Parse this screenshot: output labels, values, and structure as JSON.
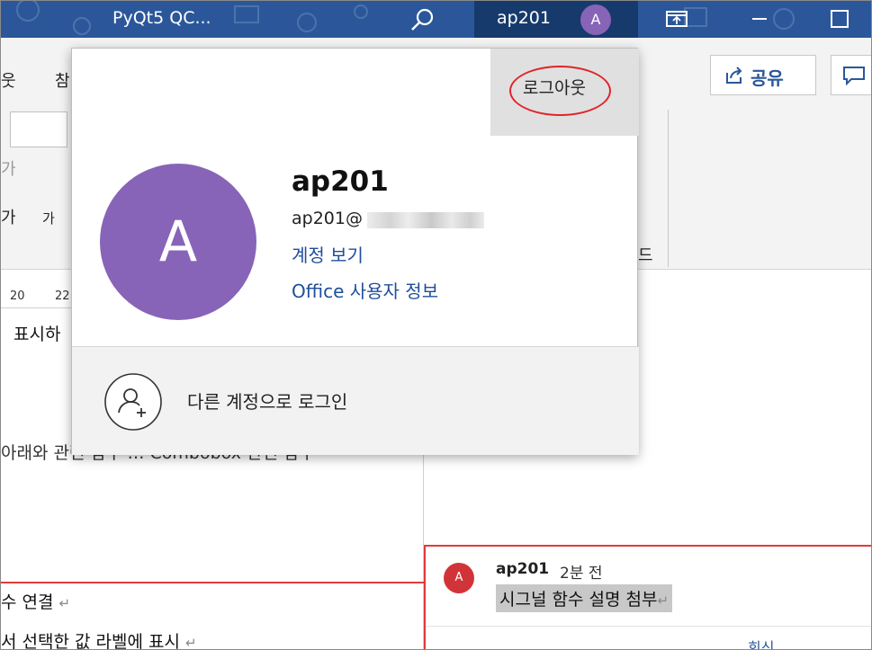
{
  "titlebar": {
    "doc_title": "PyQt5 QC...",
    "account_name": "ap201",
    "avatar_initial": "A",
    "icons": [
      "search-icon",
      "ribbon-display-icon",
      "minimize-icon",
      "maximize-icon"
    ]
  },
  "ribbon": {
    "tab_fragment_1": "웃",
    "tab_fragment_2": "참",
    "font_fragment_1": "가",
    "font_fragment_2": "가",
    "font_fragment_3": "가",
    "share_label": "공유",
    "fragment_right": "드"
  },
  "ruler": {
    "ticks": [
      "20",
      "22"
    ]
  },
  "document": {
    "line_1": "표시하",
    "line_2": "아래와 관련 함수 … Combobox 관련 함수",
    "line_3": "수 연결",
    "line_4": "서 선택한 값 라벨에 표시",
    "return_mark": "↵"
  },
  "account_popup": {
    "signout_label": "로그아웃",
    "avatar_initial": "A",
    "display_name": "ap201",
    "email_prefix": "ap201@",
    "link_view_account": "계정 보기",
    "link_office_user_info": "Office 사용자 정보",
    "other_account_login": "다른 계정으로 로그인"
  },
  "comment": {
    "avatar_initial": "A",
    "author": "ap201",
    "time": "2분 전",
    "body": "시그널 함수 설명 첨부",
    "return_mark": "↵",
    "reply_label": "회신"
  },
  "colors": {
    "titlebar": "#2b579a",
    "account_block": "#173a6c",
    "avatar_purple": "#8764b8",
    "comment_avatar": "#d13438",
    "link_blue": "#1f4e9b",
    "highlight_red": "#e0242a"
  }
}
